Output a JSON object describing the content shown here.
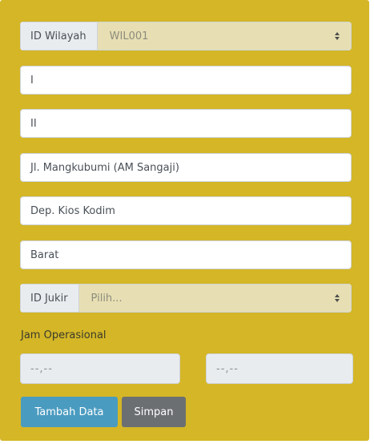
{
  "form": {
    "wilayah": {
      "label": "ID Wilayah",
      "selected": "WIL001"
    },
    "fields": [
      "I",
      "II",
      "Jl. Mangkubumi (AM Sangaji)",
      "Dep. Kios Kodim",
      "Barat"
    ],
    "jukir": {
      "label": "ID Jukir",
      "selected": "Pilih..."
    },
    "jam_label": "Jam Operasional",
    "time_start": "--,--",
    "time_end": "--,--",
    "buttons": {
      "add": "Tambah Data",
      "save": "Simpan"
    }
  },
  "colors": {
    "panel": "#d4b627",
    "primary": "#4a9bc0",
    "secondary": "#6c6f72"
  }
}
